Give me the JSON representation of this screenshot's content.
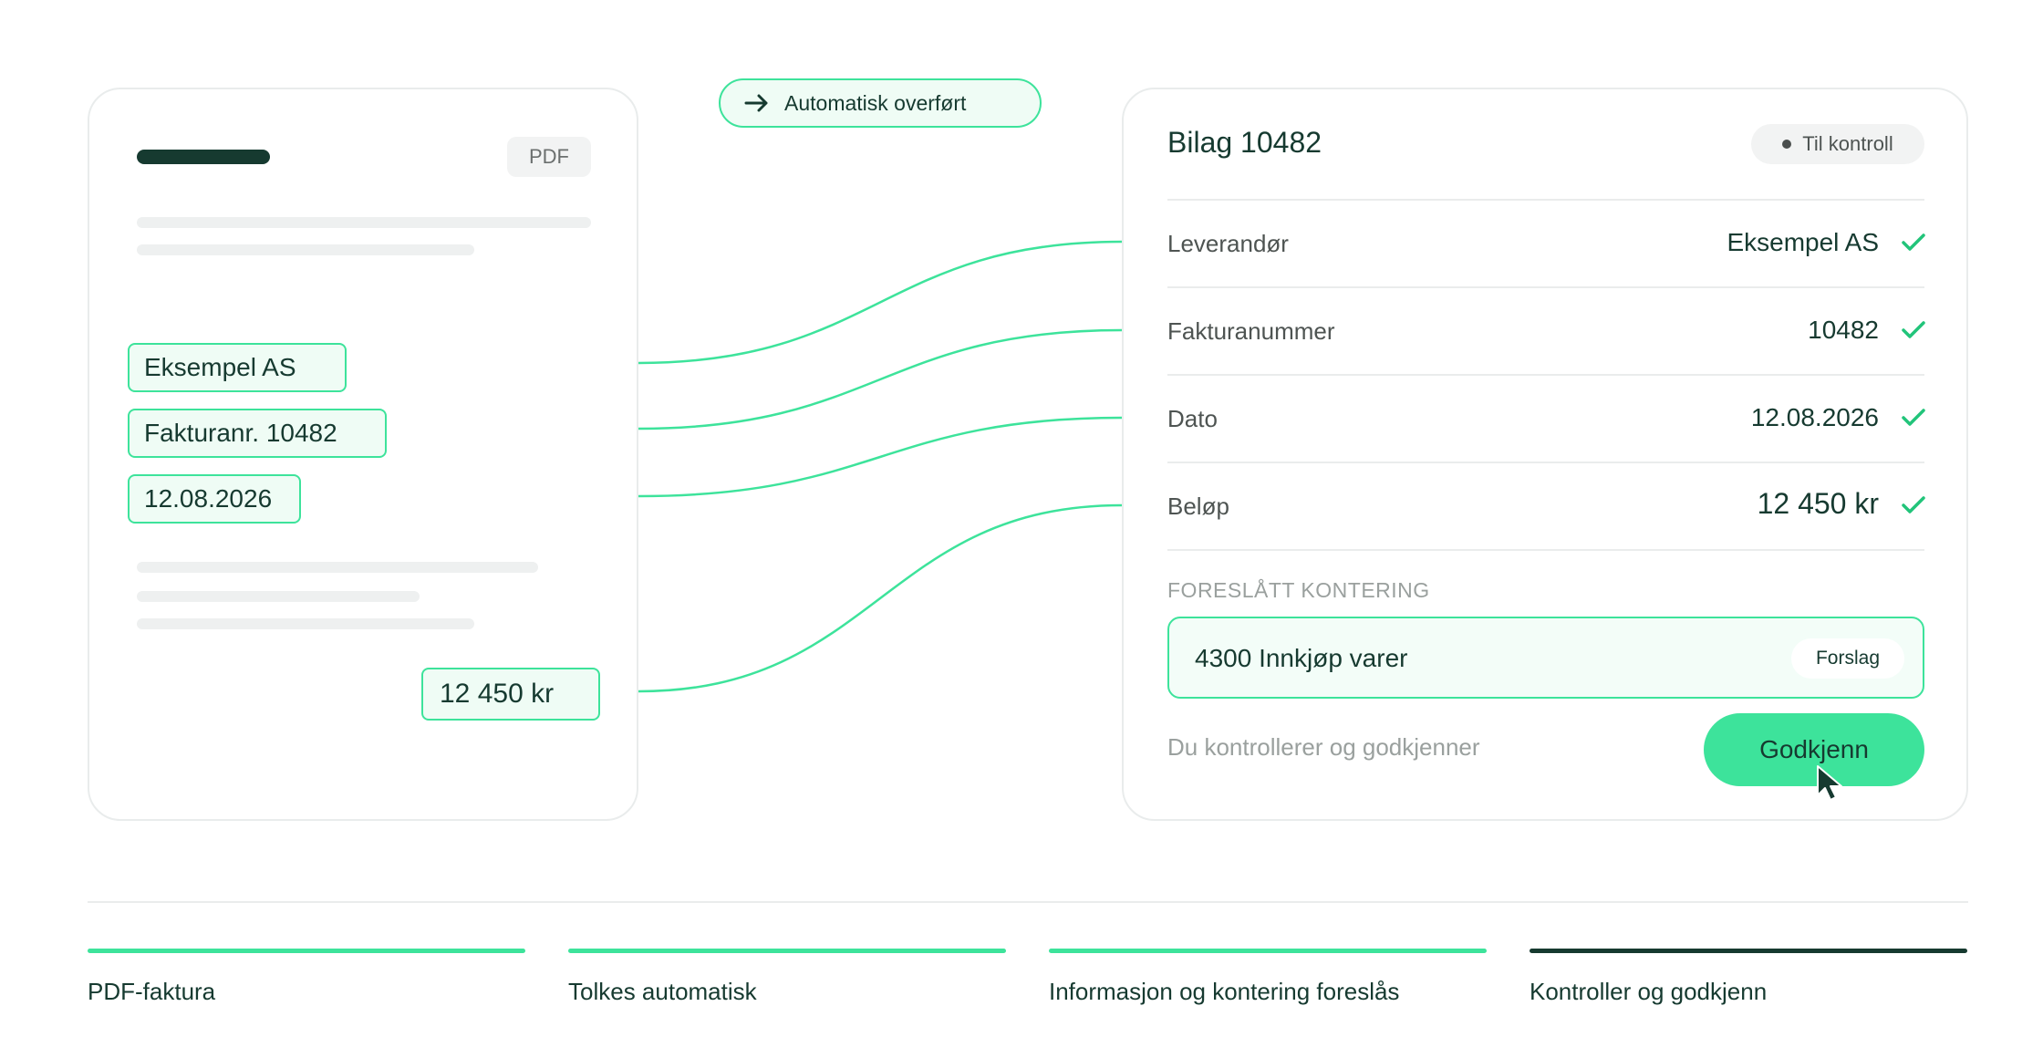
{
  "colors": {
    "accent": "#3de39b",
    "accent_light": "#effcf5",
    "dark": "#163a30",
    "done_bar": "#3de39b",
    "active_bar": "#163a30"
  },
  "transfer": {
    "label": "Automatisk overført",
    "icon": "arrow-right-icon"
  },
  "document": {
    "type_badge": "PDF",
    "supplier": "Eksempel AS",
    "invoice_number": "Fakturanr. 10482",
    "date": "12.08.2026",
    "amount": "12 450 kr"
  },
  "voucher": {
    "title": "Bilag 10482",
    "status": "Til kontroll",
    "fields": [
      {
        "label": "Leverandør",
        "value": "Eksempel AS",
        "icon": "check-icon"
      },
      {
        "label": "Fakturanummer",
        "value": "10482",
        "icon": "check-icon"
      },
      {
        "label": "Dato",
        "value": "12.08.2026",
        "icon": "check-icon"
      },
      {
        "label": "Beløp",
        "value": "12 450 kr",
        "icon": "check-icon"
      }
    ],
    "posting_label": "FORESLÅTT KONTERING",
    "posting_value": "4300 Innkjøp varer",
    "posting_badge": "Forslag",
    "helper_text": "Du kontrollerer og godkjenner",
    "approve_label": "Godkjenn",
    "cursor_icon": "pointer-cursor-icon"
  },
  "steps": [
    {
      "label": "PDF-faktura",
      "state": "done"
    },
    {
      "label": "Tolkes automatisk",
      "state": "done"
    },
    {
      "label": "Informasjon og kontering foreslås",
      "state": "done"
    },
    {
      "label": "Kontroller og godkjenn",
      "state": "active"
    }
  ]
}
